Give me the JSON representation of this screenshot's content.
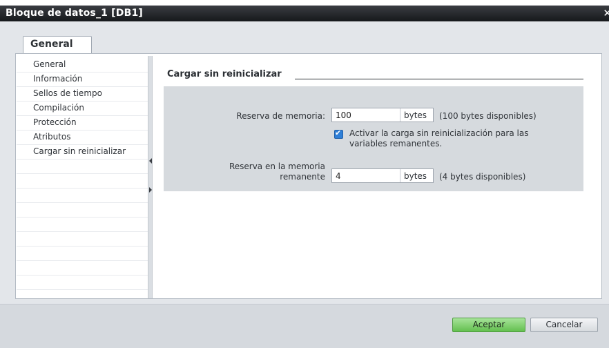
{
  "window": {
    "title": "Bloque de datos_1 [DB1]"
  },
  "tabs": [
    {
      "label": "General"
    }
  ],
  "nav": {
    "items": [
      {
        "label": "General"
      },
      {
        "label": "Información"
      },
      {
        "label": "Sellos de tiempo"
      },
      {
        "label": "Compilación"
      },
      {
        "label": "Protección"
      },
      {
        "label": "Atributos"
      },
      {
        "label": "Cargar sin reinicializar"
      }
    ]
  },
  "section": {
    "title": "Cargar sin reinicializar",
    "memory_reserve": {
      "label": "Reserva de memoria:",
      "value": "100",
      "unit": "bytes",
      "available": "(100 bytes disponibles)"
    },
    "checkbox": {
      "checked": true,
      "label": "Activar la carga sin reinicialización para las variables remanentes."
    },
    "retain_reserve": {
      "label_line1": "Reserva en la memoria",
      "label_line2": "remanente",
      "value": "4",
      "unit": "bytes",
      "available": "(4 bytes disponibles)"
    }
  },
  "buttons": {
    "ok": "Aceptar",
    "cancel": "Cancelar"
  },
  "colors": {
    "ok_button": "#63c04f",
    "checkbox": "#2f7fd7",
    "titlebar": "#16181b"
  }
}
